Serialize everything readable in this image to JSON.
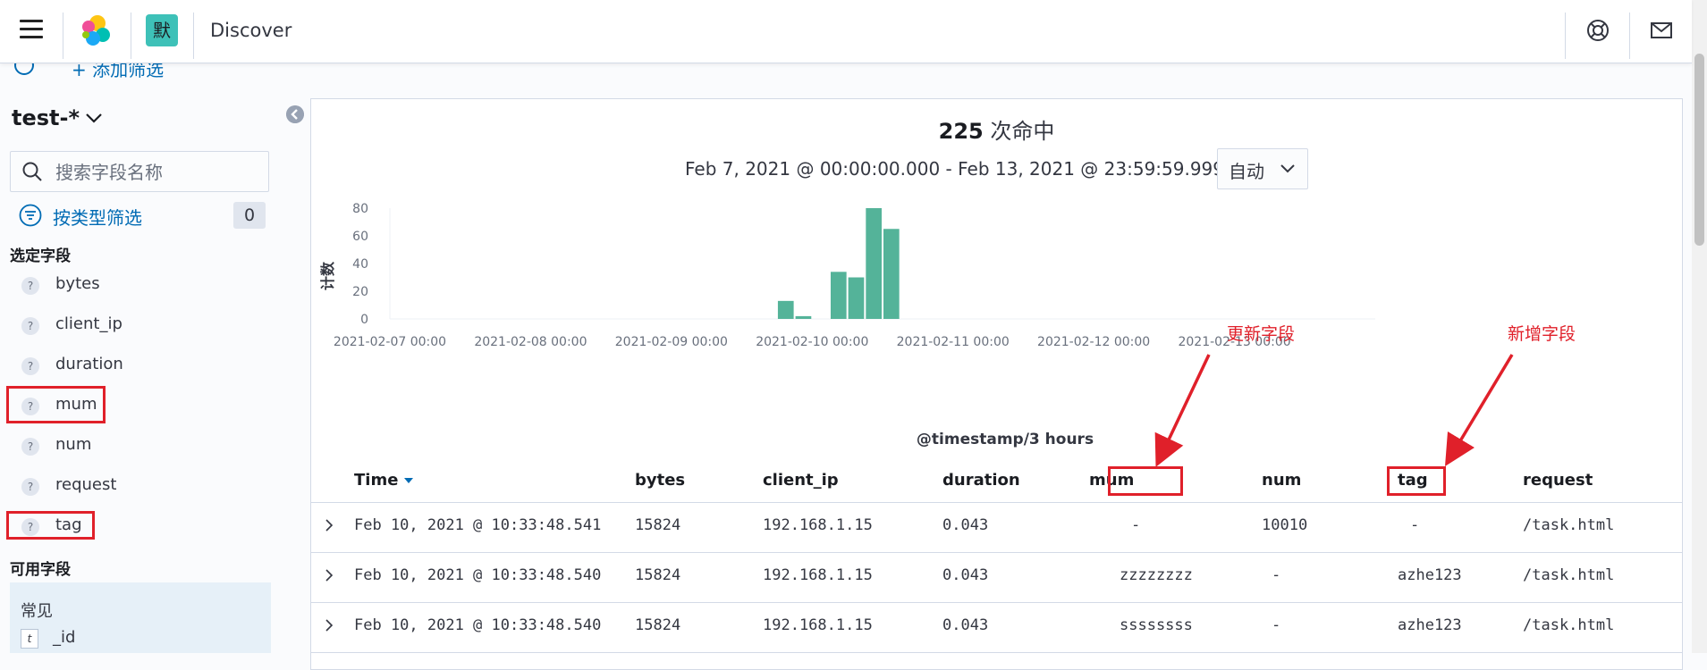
{
  "header": {
    "space_initial": "默",
    "app_title": "Discover"
  },
  "filter_bar": {
    "add_filter_label": "+ 添加筛选"
  },
  "sidebar": {
    "index_pattern": "test-*",
    "search_placeholder": "搜索字段名称",
    "type_filter_label": "按类型筛选",
    "type_filter_count": "0",
    "selected_title": "选定字段",
    "selected_fields": [
      {
        "name": "bytes",
        "type": "?"
      },
      {
        "name": "client_ip",
        "type": "?"
      },
      {
        "name": "duration",
        "type": "?"
      },
      {
        "name": "mum",
        "type": "?"
      },
      {
        "name": "num",
        "type": "?"
      },
      {
        "name": "request",
        "type": "?"
      },
      {
        "name": "tag",
        "type": "?"
      }
    ],
    "available_title": "可用字段",
    "common_label": "常见",
    "common_fields": [
      {
        "name": "_id",
        "type": "t"
      }
    ]
  },
  "main": {
    "hits_count": "225",
    "hits_suffix": " 次命中",
    "time_range": "Feb 7, 2021 @ 00:00:00.000 - Feb 13, 2021 @ 23:59:59.999",
    "interval": "自动"
  },
  "chart_data": {
    "type": "bar",
    "title": "",
    "xlabel": "@timestamp/3 hours",
    "ylabel": "计数",
    "ylim": [
      0,
      80
    ],
    "yticks": [
      0,
      20,
      40,
      60,
      80
    ],
    "xticks": [
      "2021-02-07 00:00",
      "2021-02-08 00:00",
      "2021-02-09 00:00",
      "2021-02-10 00:00",
      "2021-02-11 00:00",
      "2021-02-12 00:00",
      "2021-02-13 00:00"
    ],
    "x_start": "2021-02-07 00:00",
    "x_end": "2021-02-14 00:00",
    "bar_color": "#54b399",
    "bars": [
      {
        "x": "2021-02-09 18:00",
        "y": 13
      },
      {
        "x": "2021-02-09 21:00",
        "y": 2
      },
      {
        "x": "2021-02-10 03:00",
        "y": 34
      },
      {
        "x": "2021-02-10 06:00",
        "y": 30
      },
      {
        "x": "2021-02-10 09:00",
        "y": 80
      },
      {
        "x": "2021-02-10 12:00",
        "y": 65
      }
    ]
  },
  "table": {
    "columns": [
      "Time",
      "bytes",
      "client_ip",
      "duration",
      "mum",
      "num",
      "tag",
      "request"
    ],
    "rows": [
      [
        "Feb 10, 2021 @ 10:33:48.541",
        "15824",
        "192.168.1.15",
        "0.043",
        "-",
        "10010",
        "-",
        "/task.html"
      ],
      [
        "Feb 10, 2021 @ 10:33:48.540",
        "15824",
        "192.168.1.15",
        "0.043",
        "zzzzzzzz",
        "-",
        "azhe123",
        "/task.html"
      ],
      [
        "Feb 10, 2021 @ 10:33:48.540",
        "15824",
        "192.168.1.15",
        "0.043",
        "ssssssss",
        "-",
        "azhe123",
        "/task.html"
      ]
    ]
  },
  "annotations": {
    "updated_field": "更新字段",
    "new_field": "新增字段",
    "color": "#e0202a"
  },
  "icons": [
    "menu-icon",
    "elastic-logo-icon",
    "help-icon",
    "mail-icon",
    "search-icon",
    "filter-icon",
    "chevron-down-icon",
    "collapse-icon",
    "sort-desc-icon",
    "expand-icon"
  ]
}
